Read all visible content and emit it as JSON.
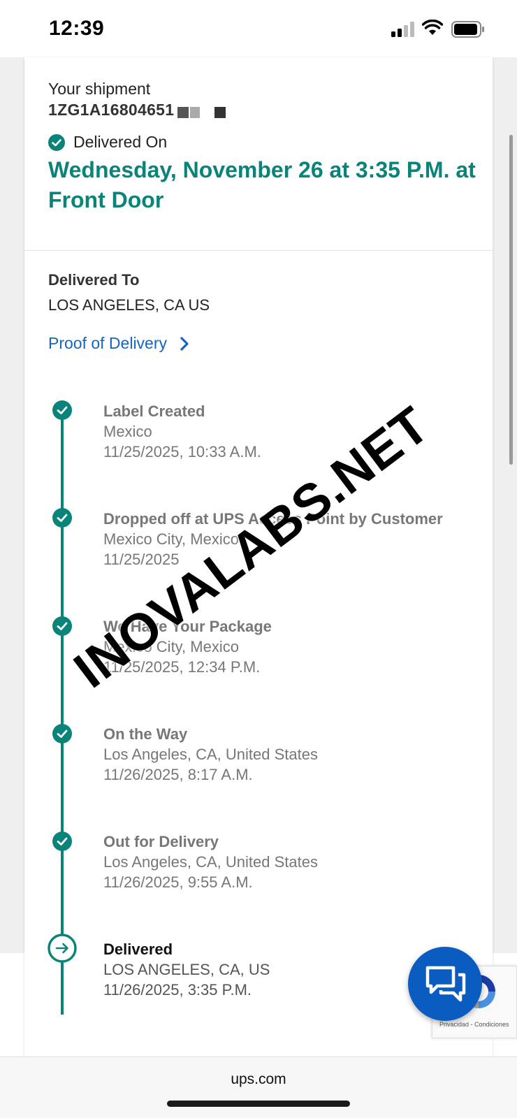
{
  "status_bar": {
    "time": "12:39"
  },
  "shipment": {
    "label": "Your shipment",
    "tracking_number": "1ZG1A16804651",
    "status_label": "Delivered On",
    "delivery_date": "Wednesday, November 26 at 3:35 P.M. at Front Door"
  },
  "delivered_to": {
    "label": "Delivered To",
    "value": "LOS ANGELES, CA US"
  },
  "proof_of_delivery": {
    "label": "Proof of Delivery"
  },
  "timeline": [
    {
      "title": "Label Created",
      "location": "Mexico",
      "time": "11/25/2025, 10:33 A.M."
    },
    {
      "title": "Dropped off at UPS Access Point by Customer",
      "location": "Mexico City, Mexico",
      "time": "11/25/2025"
    },
    {
      "title": "We Have Your Package",
      "location": "Mexico City, Mexico",
      "time": "11/25/2025, 12:34 P.M."
    },
    {
      "title": "On the Way",
      "location": "Los Angeles, CA, United States",
      "time": "11/26/2025, 8:17 A.M."
    },
    {
      "title": "Out for Delivery",
      "location": "Los Angeles, CA, United States",
      "time": "11/26/2025, 9:55 A.M."
    },
    {
      "title": "Delivered",
      "location": "LOS ANGELES, CA, US",
      "time": "11/26/2025, 3:35 P.M."
    }
  ],
  "watermark": "INOVALABS.NET",
  "recaptcha": {
    "links": "Privacidad - Condiciones"
  },
  "browser": {
    "url": "ups.com"
  },
  "colors": {
    "brand_teal": "#0a8478",
    "link_blue": "#1565c0",
    "chat_blue": "#0b5cc0"
  },
  "icons": {
    "status": "check-circle-icon",
    "proof": "chevron-right-icon",
    "final_step": "arrow-right-circle-icon",
    "chat": "chat-bubbles-icon"
  }
}
